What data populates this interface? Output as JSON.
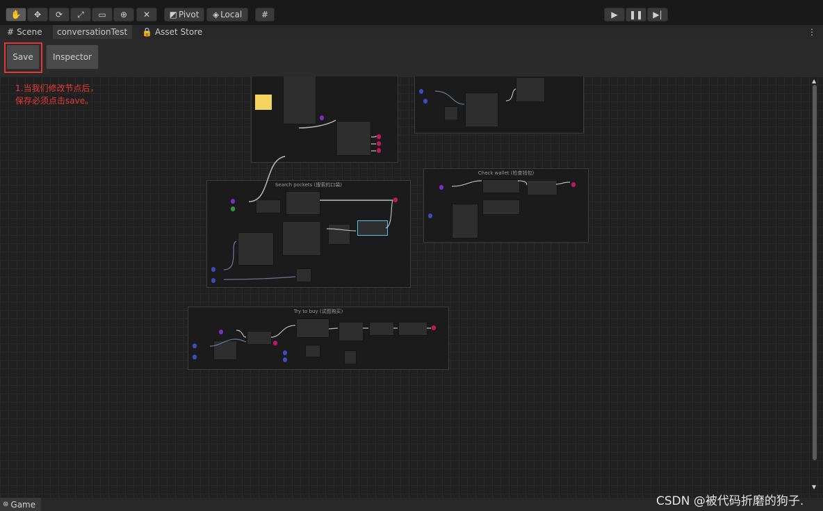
{
  "toolbar": {
    "pivot_label": "Pivot",
    "local_label": "Local"
  },
  "tabs": {
    "scene": "Scene",
    "conversation": "conversationTest",
    "asset_store": "Asset Store"
  },
  "graph_header": {
    "save_label": "Save",
    "inspector_label": "Inspector"
  },
  "annotation": {
    "line1": "1.当我们修改节点后，",
    "line2": "保存必须点击save。"
  },
  "groups": {
    "search_pockets": "Search pockets (搜索的口袋)",
    "check_wallet": "Check wallet (检查钱包)",
    "try_to_buy": "Try to buy (试图购买)"
  },
  "bottom": {
    "game_tab": "Game"
  },
  "watermark": "CSDN @被代码折磨的狗子.",
  "colors": {
    "accent_red": "#e53935",
    "node_purple": "#7b2fbf",
    "node_blue": "#3b4cc0",
    "node_green": "#2e9c3a",
    "node_pink": "#c2185b",
    "highlight_cyan": "#4fc3f7"
  },
  "icons": [
    "hand-icon",
    "move-icon",
    "rotate-icon",
    "scale-icon",
    "rect-icon",
    "transform-icon",
    "custom-tool-icon",
    "pivot-icon",
    "local-icon",
    "grid-snap-icon",
    "play-icon",
    "pause-icon",
    "step-icon",
    "scene-grid-icon",
    "lock-icon",
    "more-icon",
    "scroll-up-icon",
    "scroll-down-icon",
    "game-icon"
  ]
}
